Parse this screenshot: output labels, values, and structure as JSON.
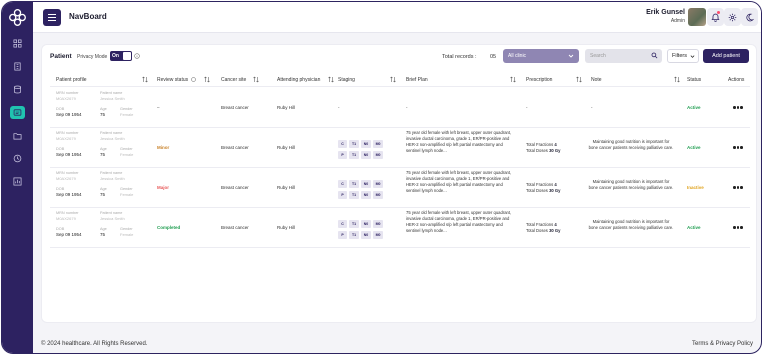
{
  "app": {
    "title": "NavBoard"
  },
  "user": {
    "name": "Erik Gunsel",
    "role": "Admin"
  },
  "sidebar": {
    "items": [
      {
        "icon": "dashboard-icon",
        "active": false
      },
      {
        "icon": "building-icon",
        "active": false
      },
      {
        "icon": "database-icon",
        "active": false
      },
      {
        "icon": "patients-icon",
        "active": true
      },
      {
        "icon": "folder-icon",
        "active": false
      },
      {
        "icon": "clock-icon",
        "active": false
      },
      {
        "icon": "chart-icon",
        "active": false
      }
    ]
  },
  "toolbar": {
    "title": "Patient",
    "privacy_label": "Privacy Mode",
    "privacy_toggle": "On",
    "total_label": "Total records :",
    "total_value": "05",
    "clinic_select": "All clinic",
    "search_placeholder": "Search",
    "filters_label": "Filters",
    "add_label": "Add patient"
  },
  "table": {
    "headers": {
      "profile": "Patient profile",
      "review": "Review status",
      "cancer": "Cancer site",
      "physician": "Attending physician",
      "staging": "Staging",
      "brief": "Brief Plan",
      "prescription": "Prescription",
      "note": "Note",
      "status": "Status",
      "actions": "Actions"
    },
    "rows": [
      {
        "mrn_label": "MRN number",
        "mrn": "M0AX2679",
        "name_label": "Patient name",
        "name": "Jessica Smith",
        "dob_label": "DOB",
        "dob": "Sep 09 1954",
        "age_label": "Age",
        "age": "75",
        "gender_label": "Gender",
        "gender": "Female",
        "review": "–",
        "review_kind": "none",
        "cancer": "Breast cancer",
        "physician": "Ruby Hill",
        "staging": "-",
        "brief": "-",
        "prescription": "-",
        "note": "-",
        "status": "Active",
        "status_kind": "active"
      },
      {
        "mrn_label": "MRN number",
        "mrn": "M0AX2679",
        "name_label": "Patient name",
        "name": "Jessica Smith",
        "dob_label": "DOB",
        "dob": "Sep 09 1954",
        "age_label": "Age",
        "age": "75",
        "gender_label": "Gender",
        "gender": "Female",
        "review": "Minor",
        "review_kind": "minor",
        "cancer": "Breast cancer",
        "physician": "Ruby Hill",
        "stage_top": [
          "C",
          "T1",
          "N0",
          "M0"
        ],
        "stage_bottom": [
          "P",
          "T1",
          "N0",
          "M0"
        ],
        "brief": "75 year old female with left breast, upper outer quadrant, invasive ductal carcinoma, grade 1, ER/PR-positive and HER-2 non-amplified s/p left partial mastectomy and sentinel lymph node...",
        "fractions_label": "Total Fractions",
        "fractions": "4",
        "doses_label": "Total Doses",
        "doses": "30 Gy",
        "note": "Maintaining good nutrition is important for bone cancer patients receiving palliative care.",
        "status": "Active",
        "status_kind": "active"
      },
      {
        "mrn_label": "MRN number",
        "mrn": "M0AX2679",
        "name_label": "Patient name",
        "name": "Jessica Smith",
        "dob_label": "DOB",
        "dob": "Sep 09 1954",
        "age_label": "Age",
        "age": "75",
        "gender_label": "Gender",
        "gender": "Female",
        "review": "Major",
        "review_kind": "major",
        "cancer": "Breast cancer",
        "physician": "Ruby Hill",
        "stage_top": [
          "C",
          "T1",
          "N0",
          "M0"
        ],
        "stage_bottom": [
          "P",
          "T1",
          "N0",
          "M0"
        ],
        "brief": "75 year old female with left breast, upper outer quadrant, invasive ductal carcinoma, grade 1, ER/PR-positive and HER-2 non-amplified s/p left partial mastectomy and sentinel lymph node...",
        "fractions_label": "Total Fractions",
        "fractions": "4",
        "doses_label": "Total Doses",
        "doses": "30 Gy",
        "note": "Maintaining good nutrition is important for bone cancer patients receiving palliative care.",
        "status": "Inactive",
        "status_kind": "inactive"
      },
      {
        "mrn_label": "MRN number",
        "mrn": "M0AX2679",
        "name_label": "Patient name",
        "name": "Jessica Smith",
        "dob_label": "DOB",
        "dob": "Sep 09 1954",
        "age_label": "Age",
        "age": "75",
        "gender_label": "Gender",
        "gender": "Female",
        "review": "Completed",
        "review_kind": "completed",
        "cancer": "Breast cancer",
        "physician": "Ruby Hill",
        "stage_top": [
          "C",
          "T1",
          "N0",
          "M0"
        ],
        "stage_bottom": [
          "P",
          "T1",
          "N0",
          "M0"
        ],
        "brief": "75 year old female with left breast, upper outer quadrant, invasive ductal carcinoma, grade 1, ER/PR-positive and HER-2 non-amplified s/p left partial mastectomy and sentinel lymph node...",
        "fractions_label": "Total Fractions",
        "fractions": "4",
        "doses_label": "Total Doses",
        "doses": "30 Gy",
        "note": "Maintaining good nutrition is important for bone cancer patients receiving palliative care.",
        "status": "Active",
        "status_kind": "active"
      }
    ]
  },
  "footer": {
    "copyright": "© 2024 healthcare. All Rights Reserved.",
    "links": "Terms & Privacy Policy"
  },
  "colors": {
    "brand": "#2d2261",
    "accent": "#20c3b0",
    "active": "#1f9d50",
    "inactive": "#e0a21c"
  }
}
